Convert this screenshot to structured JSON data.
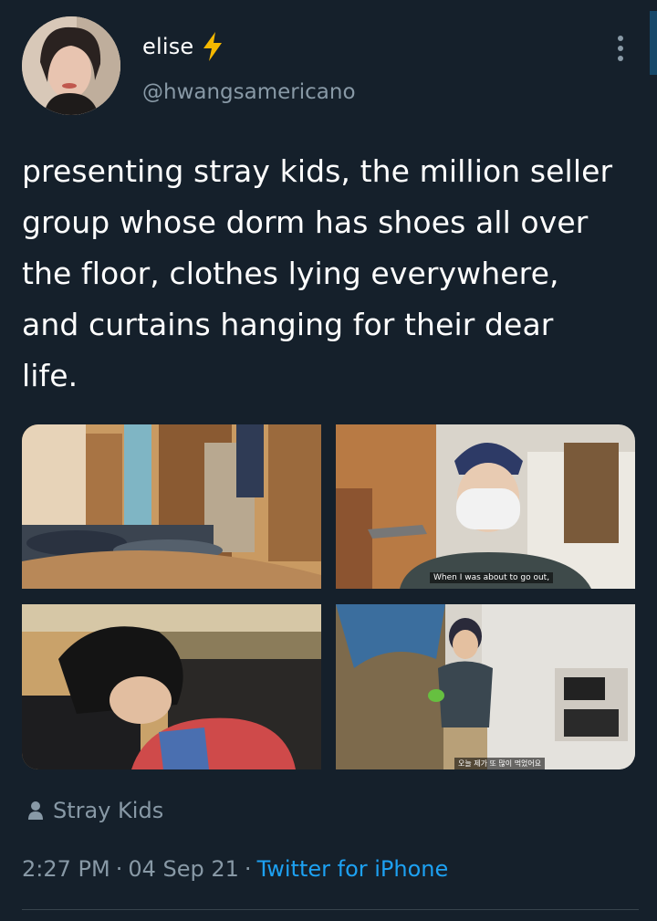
{
  "tweet": {
    "display_name": "elise",
    "handle": "@hwangsamericano",
    "text": "presenting stray kids, the million seller\ngroup whose dorm has shoes all over\nthe floor, clothes lying everywhere,\nand curtains hanging for their dear\nlife.",
    "media": [
      {
        "subtitle": ""
      },
      {
        "subtitle": "When I was about to go out,"
      },
      {
        "subtitle": ""
      },
      {
        "subtitle": "오늘 제가 또 많이 먹었어요"
      }
    ],
    "tagged": "Stray Kids",
    "time": "2:27 PM",
    "date": "04 Sep 21",
    "source": "Twitter for iPhone",
    "separator": "·"
  },
  "icons": {
    "verified_emoji": "bolt-icon",
    "menu": "more-icon",
    "tag": "person-icon"
  },
  "colors": {
    "background": "#15202b",
    "primary_text": "#ffffff",
    "secondary_text": "#8899a6",
    "link": "#1da1f2",
    "bolt": "#f5b800"
  }
}
